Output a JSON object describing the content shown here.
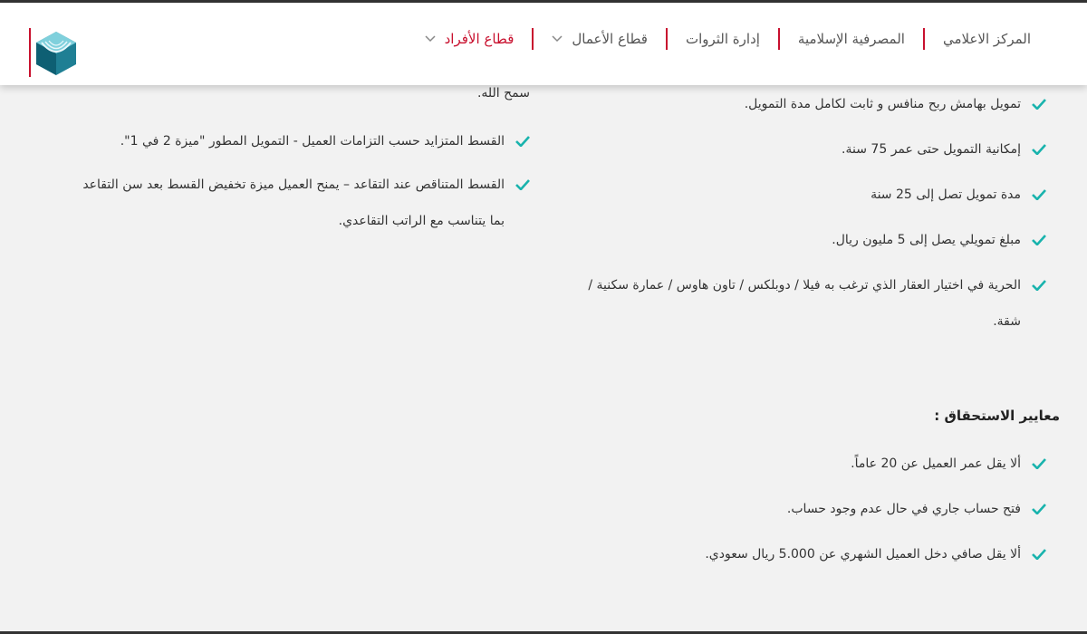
{
  "header": {
    "nav": [
      {
        "label": "قطاع الأفراد",
        "active": true,
        "dropdown": true
      },
      {
        "label": "قطاع الأعمال",
        "active": false,
        "dropdown": true
      },
      {
        "label": "إدارة الثروات",
        "active": false,
        "dropdown": false
      },
      {
        "label": "المصرفية الإسلامية",
        "active": false,
        "dropdown": false
      },
      {
        "label": "المركز الاعلامي",
        "active": false,
        "dropdown": false
      }
    ],
    "accent_color": "#c8102e",
    "check_color": "#19b3ad"
  },
  "features_right": [
    "تمويل بهامش ربح منافس و  ثابت لكامل مدة التمويل.",
    "إمكانية التمويل حتى عمر 75 سنة.",
    "مدة تمويل تصل إلى 25 سنة",
    "مبلغ تمويلي يصل إلى 5 مليون ريال.",
    "الحرية في اختيار العقار الذي ترغب به فيلا / دوبلكس / تاون هاوس / عمارة سكنية / شقة."
  ],
  "features_left": {
    "continuation": "سمح الله.",
    "items": [
      "القسط المتزايد حسب التزامات العميل  - التمويل المطور \"ميزة 2 في 1\".",
      "القسط المتناقص عند التقاعد – يمنح العميل ميزة تخفيض القسط بعد سن التقاعد بما يتناسب مع الراتب التقاعدي."
    ]
  },
  "eligibility": {
    "heading": "معايير الاستحقاق :",
    "items": [
      "ألا يقل عمر العميل عن 20 عاماً.",
      "فتح حساب جاري في حال عدم وجود حساب.",
      "ألا يقل صافي دخل العميل الشهري عن 5.000 ريال سعودي."
    ]
  }
}
